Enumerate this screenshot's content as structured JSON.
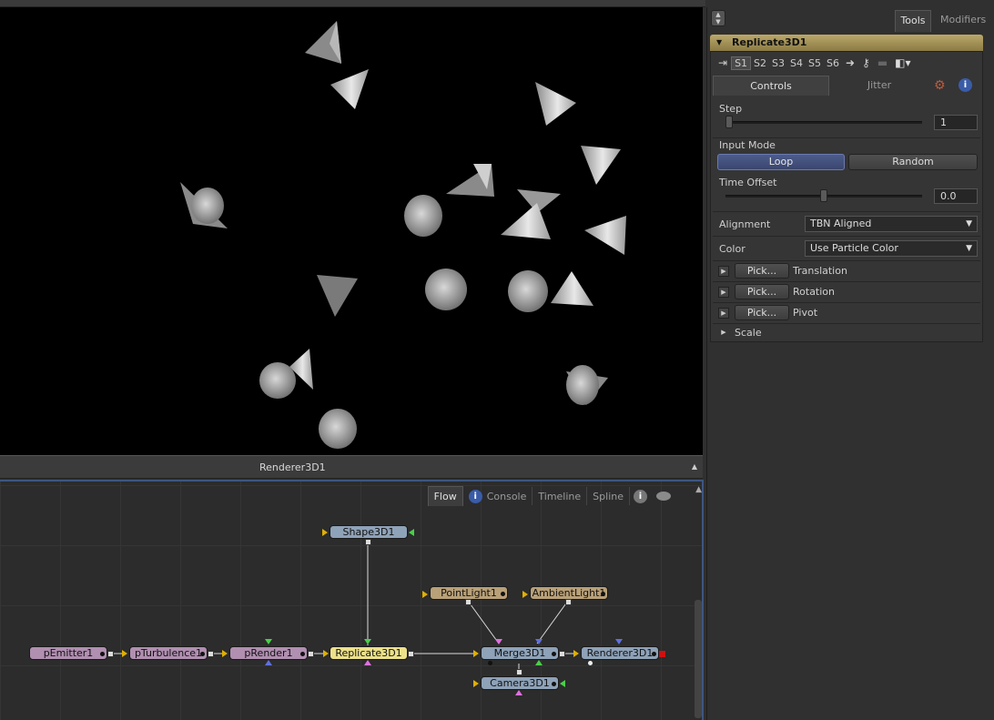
{
  "viewport": {
    "label": "Renderer3D1"
  },
  "flow": {
    "tabs": [
      {
        "label": "Flow",
        "active": true
      },
      {
        "label": "Console"
      },
      {
        "label": "Timeline"
      },
      {
        "label": "Spline"
      }
    ],
    "nodes": {
      "shape": "Shape3D1",
      "point_light": "PointLight1",
      "ambient_light": "AmbientLight1",
      "emitter": "pEmitter1",
      "turbulence": "pTurbulence1",
      "render": "pRender1",
      "replicate": "Replicate3D1",
      "merge": "Merge3D1",
      "renderer": "Renderer3D1",
      "camera": "Camera3D1"
    }
  },
  "panel": {
    "tabs": {
      "tools": "Tools",
      "modifiers": "Modifiers"
    },
    "tool_title": "Replicate3D1",
    "sets": [
      "S1",
      "S2",
      "S3",
      "S4",
      "S5",
      "S6"
    ],
    "ctrl_tabs": {
      "controls": "Controls",
      "jitter": "Jitter"
    },
    "step": {
      "label": "Step",
      "value": "1",
      "slider_fraction": 0.0
    },
    "input_mode": {
      "label": "Input Mode",
      "loop": "Loop",
      "random": "Random",
      "selected": "Loop"
    },
    "time_offset": {
      "label": "Time Offset",
      "value": "0.0",
      "slider_fraction": 0.5
    },
    "alignment": {
      "label": "Alignment",
      "value": "TBN Aligned"
    },
    "color": {
      "label": "Color",
      "value": "Use Particle Color"
    },
    "pick_label": "Pick...",
    "translation": "Translation",
    "rotation": "Rotation",
    "pivot": "Pivot",
    "scale": "Scale"
  },
  "colors": {
    "node_purple": "#b08fb0",
    "node_yellow": "#ece08a",
    "node_blue": "#8ea2b8",
    "node_brown": "#b8a078",
    "selected_button": "#4d5c8a",
    "title_bar": "#bba86a"
  }
}
